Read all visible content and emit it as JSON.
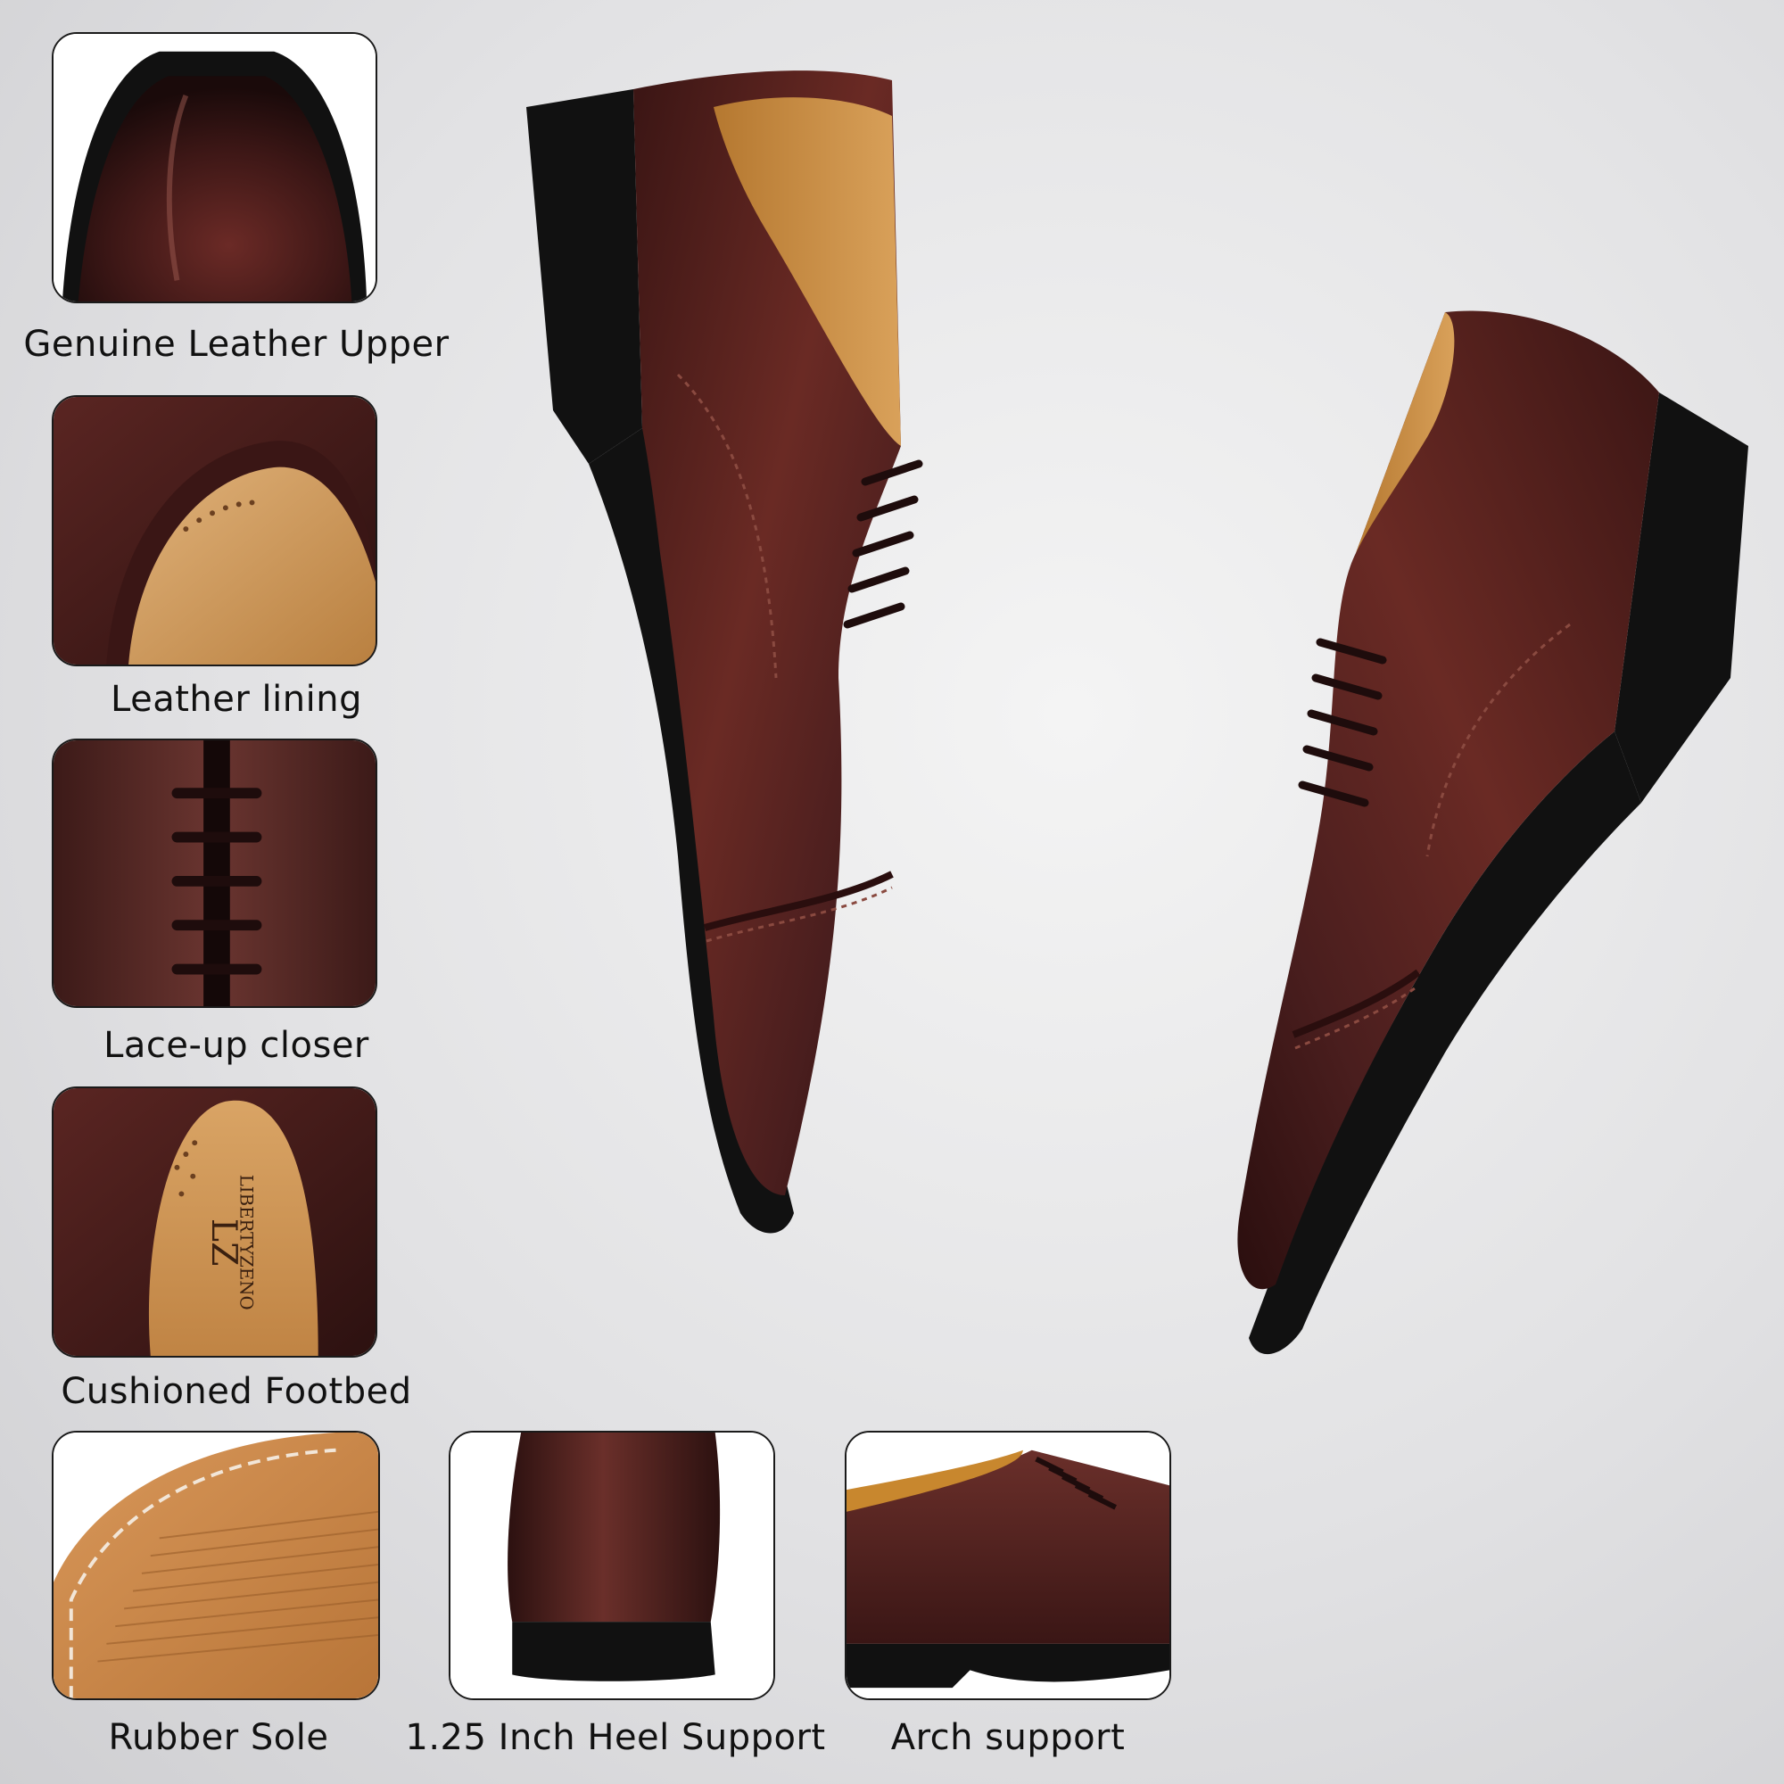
{
  "features": [
    {
      "label": "Genuine Leather Upper"
    },
    {
      "label": "Leather lining"
    },
    {
      "label": "Lace-up closer"
    },
    {
      "label": "Cushioned Footbed"
    },
    {
      "label": "Rubber Sole"
    },
    {
      "label": "1.25 Inch Heel Support"
    },
    {
      "label": "Arch support"
    }
  ],
  "footbed_brand": {
    "monogram": "LZ",
    "name": "LIBERTYZENO"
  },
  "colors": {
    "leather": "#4a1e1e",
    "leather_highlight": "#7a3a30",
    "lining": "#c8872e",
    "sole": "#111111",
    "outsole": "#c98a4e"
  }
}
